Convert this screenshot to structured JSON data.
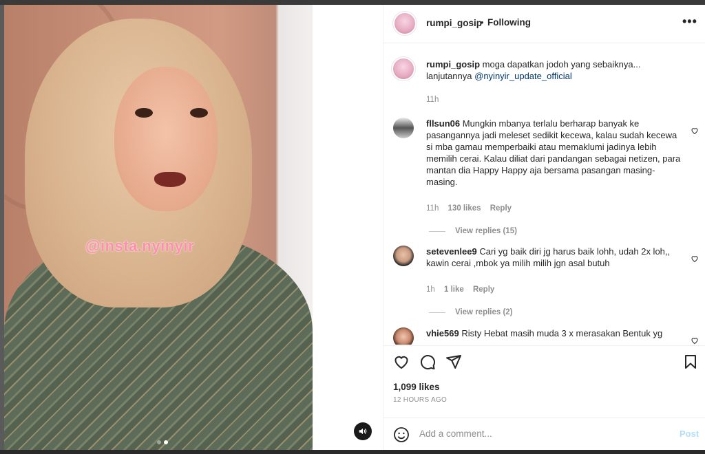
{
  "post": {
    "username": "rumpi_gosip",
    "follow_status": "Following",
    "caption_user": "rumpi_gosip",
    "caption_text": "moga dapatkan jodoh yang sebaiknya... lanjutannya",
    "caption_mention": "@nyinyir_update_official",
    "caption_time": "11h",
    "watermark": "@insta.nyinyir",
    "likes": "1,099 likes",
    "posted_ago": "12 HOURS AGO",
    "add_comment_placeholder": "Add a comment...",
    "post_label": "Post"
  },
  "comments": [
    {
      "user": "fllsun06",
      "text": "Mungkin mbanya terlalu berharap banyak ke pasangannya jadi meleset sedikit kecewa, kalau sudah kecewa si mba gamau memperbaiki atau memaklumi jadinya lebih memilih cerai. Kalau diliat dari pandangan sebagai netizen, para mantan dia Happy Happy aja bersama pasangan masing-masing.",
      "time": "11h",
      "likes": "130 likes",
      "reply": "Reply",
      "view_replies": "View replies (15)"
    },
    {
      "user": "setevenlee9",
      "text": "Cari yg baik diri jg harus baik lohh, udah 2x loh,, kawin cerai ,mbok ya milih milih jgn asal butuh",
      "time": "1h",
      "likes": "1 like",
      "reply": "Reply",
      "view_replies": "View replies (2)"
    },
    {
      "user": "vhie569",
      "text": "Risty Hebat masih muda 3 x merasakan Bentuk yg"
    }
  ],
  "colors": {
    "link": "#00376b",
    "muted": "#8e8e8e",
    "post_disabled": "#b2dffc"
  }
}
